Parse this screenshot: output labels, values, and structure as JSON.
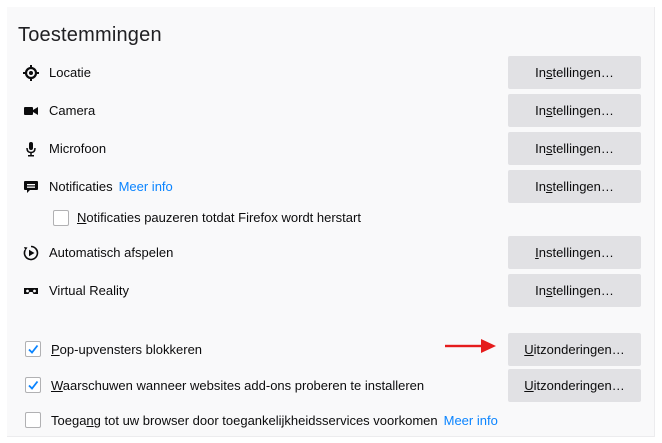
{
  "section": {
    "title": "Toestemmingen"
  },
  "permissions": [
    {
      "label": "Locatie",
      "icon": "location-icon",
      "button": {
        "pre": "In",
        "u": "s",
        "post": "tellingen…"
      }
    },
    {
      "label": "Camera",
      "icon": "camera-icon",
      "button": {
        "pre": "In",
        "u": "s",
        "post": "tellingen…"
      }
    },
    {
      "label": "Microfoon",
      "icon": "microphone-icon",
      "button": {
        "pre": "In",
        "u": "s",
        "post": "tellingen…"
      }
    },
    {
      "label": "Notificaties",
      "icon": "notification-icon",
      "link": "Meer info",
      "button": {
        "pre": "In",
        "u": "s",
        "post": "tellingen…"
      }
    },
    {
      "label": "Automatisch afspelen",
      "icon": "autoplay-icon",
      "button": {
        "pre": "",
        "u": "I",
        "post": "nstellingen…"
      }
    },
    {
      "label": "Virtual Reality",
      "icon": "vr-headset-icon",
      "button": {
        "pre": "In",
        "u": "s",
        "post": "tellingen…"
      }
    }
  ],
  "notifications_pause": {
    "checked": false,
    "pre": "",
    "u": "N",
    "post": "otificaties pauzeren totdat Firefox wordt herstart"
  },
  "popups": {
    "checked": true,
    "pre": "",
    "u": "P",
    "post": "op-upvensters blokkeren",
    "button": {
      "pre": "",
      "u": "U",
      "post": "itzonderingen…"
    }
  },
  "addons": {
    "checked": true,
    "pre": "",
    "u": "W",
    "post": "aarschuwen wanneer websites add-ons proberen te installeren",
    "button": {
      "pre": "",
      "u": "U",
      "post": "itzonderingen…"
    }
  },
  "accessibility": {
    "checked": false,
    "pre": "Toega",
    "u": "n",
    "post": "g tot uw browser door toegankelijkheidsservices voorkomen",
    "link": "Meer info"
  },
  "colors": {
    "link": "#0a84ff",
    "checkmark": "#0a84ff",
    "button_bg": "#e1e1e4",
    "arrow": "#e51c1c"
  }
}
